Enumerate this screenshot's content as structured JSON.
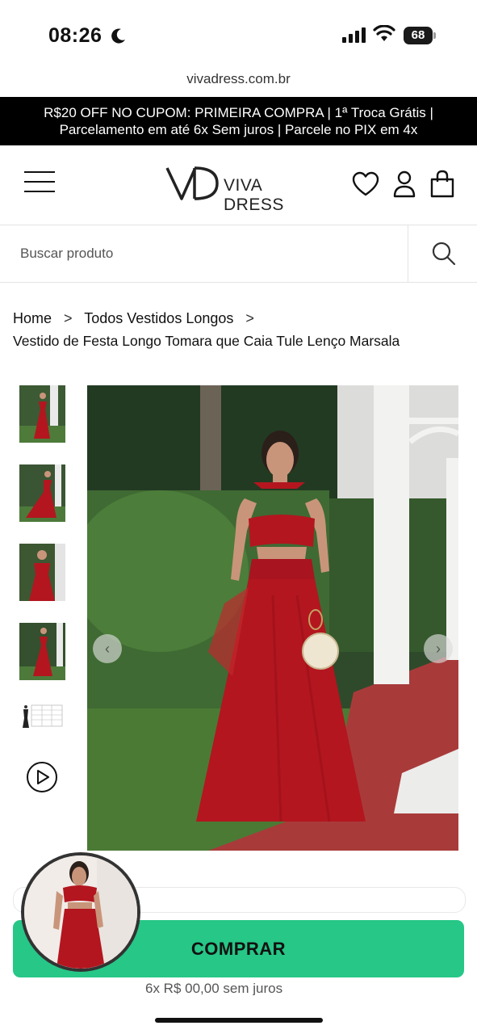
{
  "status_bar": {
    "time": "08:26",
    "battery": "68",
    "icons": [
      "moon-icon",
      "signal-icon",
      "wifi-icon",
      "battery-icon"
    ]
  },
  "browser": {
    "url": "vivadress.com.br"
  },
  "promo_banner": {
    "line1": "R$20 OFF NO CUPOM: PRIMEIRA COMPRA | 1ª Troca Grátis |",
    "line2": "Parcelamento em até 6x Sem juros | Parcele no PIX em 4x"
  },
  "header": {
    "logo_mark": "VD",
    "logo_text": "VIVA DRESS",
    "icons": [
      "menu-icon",
      "heart-icon",
      "user-icon",
      "bag-icon"
    ]
  },
  "search": {
    "placeholder": "Buscar produto",
    "value": ""
  },
  "breadcrumb": {
    "home": "Home",
    "category": "Todos Vestidos Longos",
    "separator": ">"
  },
  "product": {
    "title": "Vestido de Festa Longo Tomara que Caia Tule Lenço Marsala",
    "dress_color": "#b3161f",
    "thumbnail_count": 5,
    "has_video": true
  },
  "gallery": {
    "prev_label": "‹",
    "next_label": "›"
  },
  "actions": {
    "buy_label": "COMPRAR",
    "button_color": "#26c787",
    "installments": "6x R$ 00,00 sem juros"
  }
}
